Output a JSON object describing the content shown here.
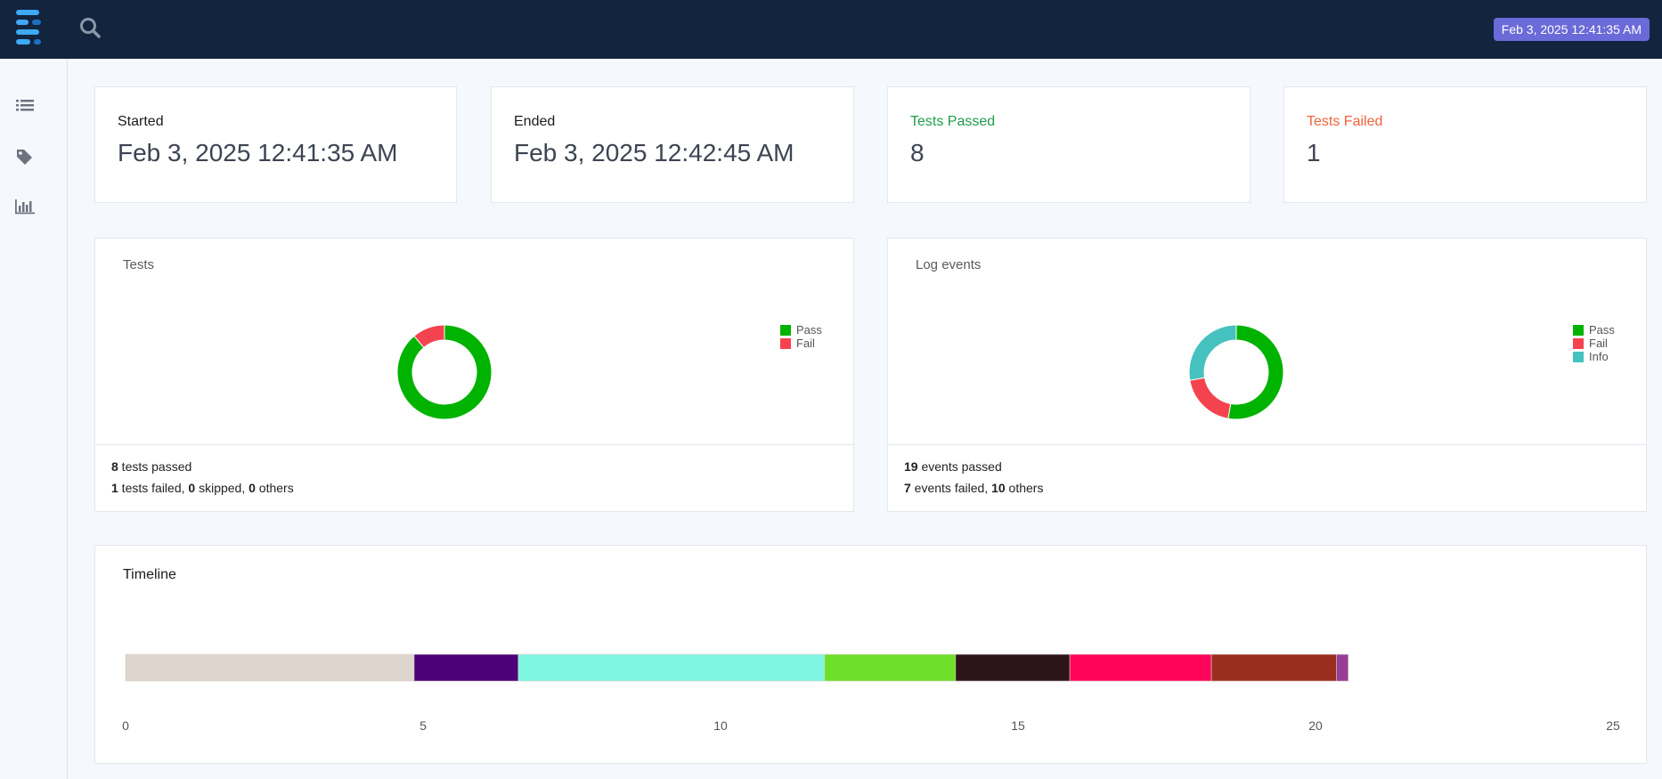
{
  "header": {
    "date_badge": "Feb 3, 2025 12:41:35 AM",
    "icons": [
      "logo-icon",
      "search-icon"
    ]
  },
  "sidebar": {
    "items": [
      {
        "icon": "list-icon"
      },
      {
        "icon": "tag-icon"
      },
      {
        "icon": "bar-chart-icon"
      }
    ]
  },
  "stats": {
    "started_label": "Started",
    "started_value": "Feb 3, 2025 12:41:35 AM",
    "ended_label": "Ended",
    "ended_value": "Feb 3, 2025 12:42:45 AM",
    "passed_label": "Tests Passed",
    "passed_value": "8",
    "failed_label": "Tests Failed",
    "failed_value": "1"
  },
  "colors": {
    "pass": "#00b300",
    "fail": "#f4434f",
    "info": "#45c1bf",
    "passed_text": "#1e9b4a",
    "failed_text": "#f0623c"
  },
  "tests_card": {
    "title": "Tests",
    "legend": [
      "Pass",
      "Fail"
    ],
    "footer": {
      "passed_count": "8",
      "passed_text": " tests passed",
      "failed_count": "1",
      "failed_text": " tests failed, ",
      "skipped_count": "0",
      "skipped_text": " skipped, ",
      "others_count": "0",
      "others_text": " others"
    }
  },
  "log_card": {
    "title": "Log events",
    "legend": [
      "Pass",
      "Fail",
      "Info"
    ],
    "footer": {
      "passed_count": "19",
      "passed_text": " events passed",
      "failed_count": "7",
      "failed_text": " events failed, ",
      "others_count": "10",
      "others_text": " others"
    }
  },
  "timeline": {
    "title": "Timeline"
  },
  "chart_data": [
    {
      "type": "pie",
      "title": "Tests",
      "categories": [
        "Pass",
        "Fail"
      ],
      "values": [
        8,
        1
      ],
      "colors": [
        "#00b300",
        "#f4434f"
      ],
      "legend": "top-right"
    },
    {
      "type": "pie",
      "title": "Log events",
      "categories": [
        "Pass",
        "Fail",
        "Info"
      ],
      "values": [
        19,
        7,
        10
      ],
      "colors": [
        "#00b300",
        "#f4434f",
        "#45c1bf"
      ],
      "legend": "top-right"
    },
    {
      "type": "bar",
      "title": "Timeline",
      "orientation": "horizontal-stacked",
      "xlim": [
        0,
        25
      ],
      "xticks": [
        "0",
        "5",
        "10",
        "15",
        "20",
        "25"
      ],
      "series": [
        {
          "values": [
            4.85
          ],
          "color": "#ddd5ce"
        },
        {
          "values": [
            1.75
          ],
          "color": "#4b0078"
        },
        {
          "values": [
            5.15
          ],
          "color": "#7ef5e0"
        },
        {
          "values": [
            2.2
          ],
          "color": "#6fe02a"
        },
        {
          "values": [
            1.92
          ],
          "color": "#2c1419"
        },
        {
          "values": [
            2.38
          ],
          "color": "#ff055a"
        },
        {
          "values": [
            2.1
          ],
          "color": "#9b2d1e"
        },
        {
          "values": [
            0.2
          ],
          "color": "#973d94"
        }
      ]
    }
  ]
}
